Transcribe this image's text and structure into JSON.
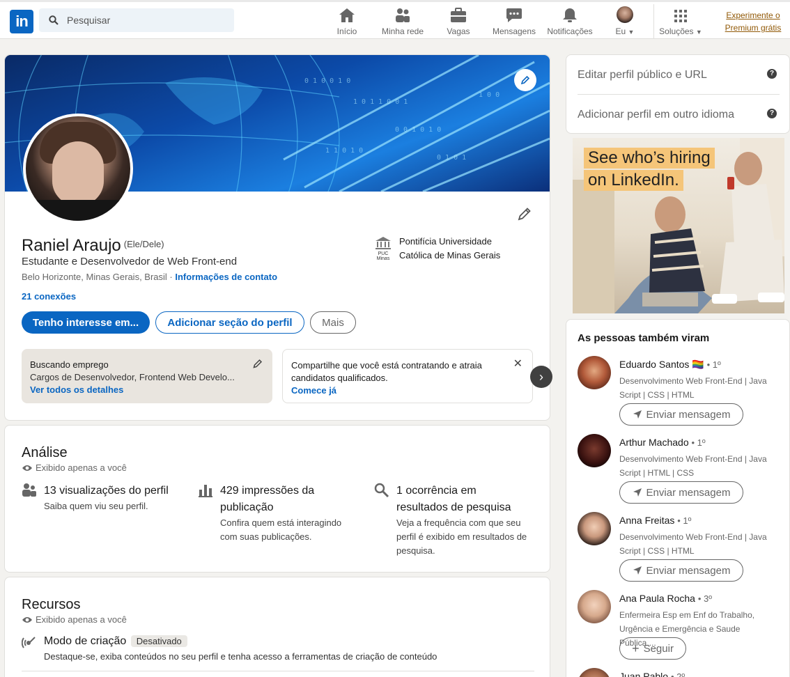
{
  "nav": {
    "search_placeholder": "Pesquisar",
    "items": [
      {
        "label": "Início",
        "icon": "home-icon"
      },
      {
        "label": "Minha rede",
        "icon": "network-icon"
      },
      {
        "label": "Vagas",
        "icon": "briefcase-icon"
      },
      {
        "label": "Mensagens",
        "icon": "message-icon"
      },
      {
        "label": "Notificações",
        "icon": "bell-icon"
      },
      {
        "label": "Eu",
        "icon": "avatar"
      },
      {
        "label": "Soluções",
        "icon": "grid-icon"
      }
    ],
    "premium_line1": "Experimente o",
    "premium_line2": "Premium grátis"
  },
  "profile": {
    "name": "Raniel Araujo",
    "pronouns": "(Ele/Dele)",
    "headline": "Estudante e Desenvolvedor de Web Front-end",
    "location": "Belo Horizonte, Minas Gerais, Brasil ·",
    "contact_link": "Informações de contato",
    "connections": "21 conexões",
    "education_line1": "Pontifícia Universidade",
    "education_line2": "Católica de Minas Gerais",
    "edu_logo_text": "PUC Minas",
    "btn_interest": "Tenho interesse em...",
    "btn_add_section": "Adicionar seção do perfil",
    "btn_more": "Mais",
    "open_to_work": {
      "title": "Buscando emprego",
      "subtitle": "Cargos de Desenvolvedor, Frontend Web Develo...",
      "link": "Ver todos os detalhes"
    },
    "hiring": {
      "text_bold": "Compartilhe que você está contratando",
      "text_rest": " e atraia candidatos qualificados.",
      "link": "Comece já"
    }
  },
  "analytics": {
    "title": "Análise",
    "private": "Exibido apenas a você",
    "metrics": [
      {
        "title": "13 visualizações do perfil",
        "desc": "Saiba quem viu seu perfil."
      },
      {
        "title": "429 impressões da publicação",
        "desc": "Confira quem está interagindo com suas publicações."
      },
      {
        "title": "1 ocorrência em resultados de pesquisa",
        "desc": "Veja a frequência com que seu perfil é exibido em resultados de pesquisa."
      }
    ]
  },
  "resources": {
    "title": "Recursos",
    "private": "Exibido apenas a você",
    "creator_title": "Modo de criação",
    "creator_badge": "Desativado",
    "creator_desc": "Destaque-se, exiba conteúdos no seu perfil e tenha acesso a ferramentas de criação de conteúdo"
  },
  "sidebar": {
    "edit_public": "Editar perfil público e URL",
    "add_language": "Adicionar perfil em outro idioma",
    "ad_line1": "See who’s hiring",
    "ad_line2": "on LinkedIn.",
    "people_title": "As pessoas também viram",
    "people": [
      {
        "name": "Eduardo Santos 🏳️‍🌈",
        "degree": "• 1º",
        "desc": "Desenvolvimento Web Front-End | Java Script | CSS | HTML",
        "button": "Enviar mensagem"
      },
      {
        "name": "Arthur Machado",
        "degree": "• 1º",
        "desc": "Desenvolvimento Web Front-End | Java Script | HTML | CSS",
        "button": "Enviar mensagem"
      },
      {
        "name": "Anna Freitas",
        "degree": "• 1º",
        "desc": "Desenvolvimento Web Front-End | Java Script | CSS | HTML",
        "button": "Enviar mensagem"
      },
      {
        "name": "Ana Paula Rocha",
        "degree": "• 3º",
        "desc": "Enfermeira Esp em Enf do Trabalho, Urgência e Emergência e Saude Pública....",
        "button": "Seguir"
      },
      {
        "name": "Juan Pablo",
        "degree": "• 2º",
        "desc": "",
        "button": ""
      }
    ]
  },
  "colors": {
    "brand": "#0a66c2",
    "premium": "#915907"
  }
}
